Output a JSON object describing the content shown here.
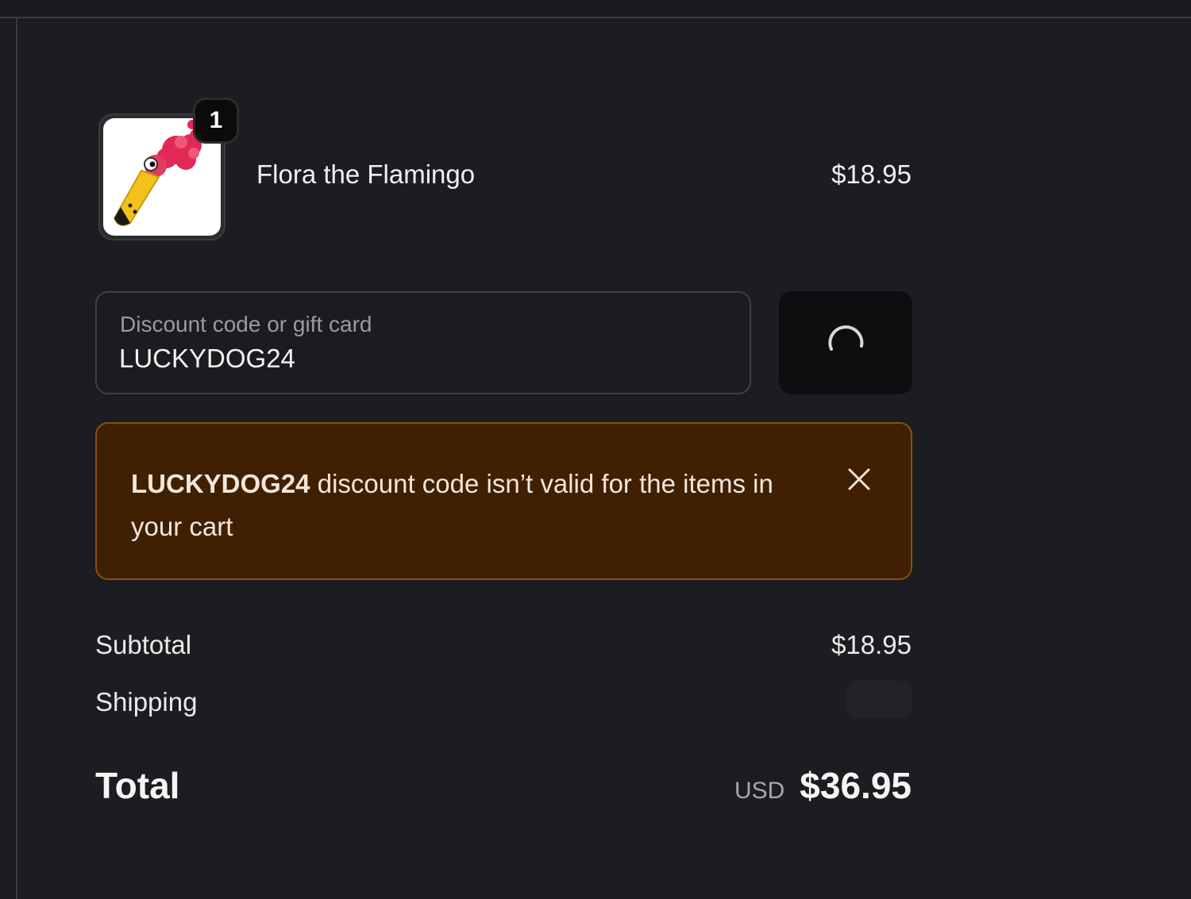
{
  "product": {
    "name": "Flora the Flamingo",
    "price": "$18.95",
    "quantity": "1",
    "image_icon": "flamingo-toy-image"
  },
  "discount": {
    "label": "Discount code or gift card",
    "value": "LUCKYDOG24",
    "apply_button_state": "loading",
    "apply_button_icon": "spinner-icon"
  },
  "error": {
    "code": "LUCKYDOG24",
    "message": " discount code isn’t valid for the items in your cart",
    "close_icon": "close-icon",
    "background_color": "#3f2002",
    "border_color": "#8a4d10"
  },
  "summary": {
    "subtotal_label": "Subtotal",
    "subtotal_value": "$18.95",
    "shipping_label": "Shipping",
    "total_label": "Total",
    "total_currency": "USD",
    "total_value": "$36.95"
  }
}
